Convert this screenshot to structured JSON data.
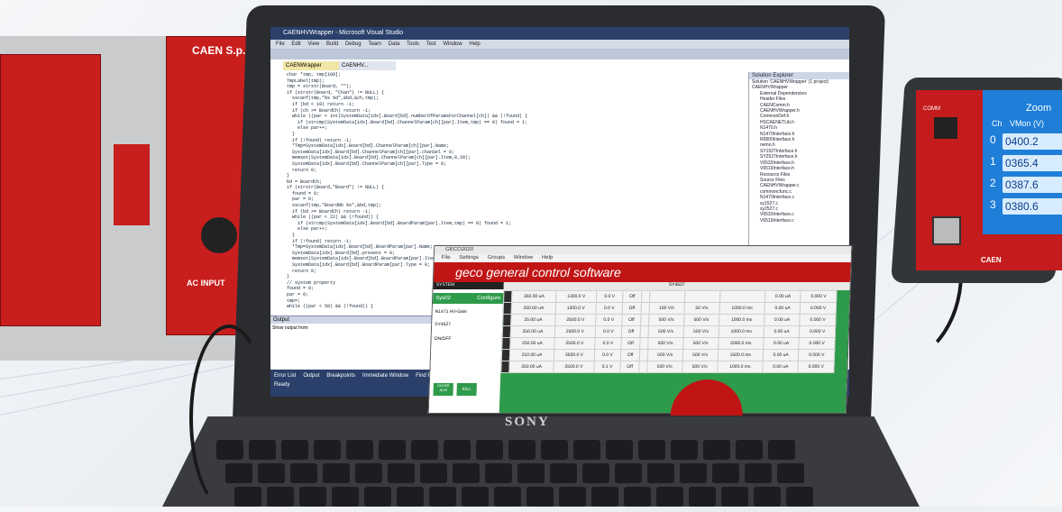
{
  "scene": "Laptop running IDE and GECO software connected to CAEN power supply units",
  "crate": {
    "logo": "CAEN S.p.A.",
    "label_ac_input": "AC INPUT"
  },
  "laptop": {
    "brand": "SONY",
    "ide": {
      "menu": [
        "File",
        "Edit",
        "View",
        "Build",
        "Debug",
        "Team",
        "Data",
        "Tools",
        "Test",
        "Window",
        "Help"
      ],
      "tabs": [
        "CAENWrapper",
        "CAENHV..."
      ],
      "code_lines": [
        "char *tmp, tmp[100];",
        "TmpLabel(tmp);",
        "",
        "tmp = strstr(Board, \"\");",
        "if (strstr(Board, \"Chan\") != NULL) {",
        "  sscanf(tmp,\"%s %d\",&bd,&ch,tmp);",
        "  if (bd < 19) return -1;",
        "  if (ch >= BoardCh) return -1;",
        "  while ((par < int)SystemData[idx].Board[bd].numberOfParamsForChannel[ch]) && (!found) {",
        "    if (strcmp(SystemData[idx].Board[bd].ChannelParam[ch][par].Item,tmp) == 0) found = 1;",
        "    else par++;",
        "  }",
        "  if (!found) return -1;",
        "  *Tmp=SystemData[idx].Board[bd].ChannelParam[ch][par].Name;",
        "  SystemData[idx].Board[bd].ChannelParam[ch][par].chanSel = 0;",
        "  memset(SystemData[idx].Board[bd].ChannelParam[ch][par].Item,0,20);",
        "  SystemData[idx].Board[bd].ChannelParam[ch][par].Type = 0;",
        "  return 0;",
        "}",
        "bd = BoardCh;",
        "if (strstr(Board,\"Board\") != NULL) {",
        "  found = 0;",
        "  par = 0;",
        "  sscanf(tmp,\"BoardNb %s\",&bd,tmp);",
        "  if (bd >= BoardCh) return -1;",
        "  while ((par < 22) && (!found)) {",
        "    if (strcmp(SystemData[idx].Board[bd].BoardParam[par].Item,tmp) == 0) found = 1;",
        "    else par++;",
        "  }",
        "  if (!found) return -1;",
        "  *Tmp=SystemData[idx].Board[bd].BoardParam[par].Name;",
        "  SystemData[idx].Board[bd].present = 0;",
        "  memset(SystemData[idx].Board[bd].BoardParam[par].Item,0,20);",
        "  SystemData[idx].Board[bd].BoardParam[par].Type = 0;",
        "  return 0;",
        "}",
        "// system property",
        "found = 0;",
        "par = 0;",
        "",
        "tmp=;",
        "while ((par < 50) && (!found)) {"
      ],
      "solution_explorer": {
        "header": "Solution Explorer",
        "items": [
          "Solution 'CAENHVWrapper' (1 project)",
          "CAENHVWrapper",
          "External Dependencies",
          "Header Files",
          "CAENComm.h",
          "CAENHVWrapper.h",
          "CommonDef.h",
          "HSCAENETLib.h",
          "N1470.h",
          "N1470Interface.h",
          "R5800Interface.h",
          "nemo.h",
          "SY1527Interface.h",
          "SY2527Interface.h",
          "V6533Interface.h",
          "V6519Interface.h",
          "Resource Files",
          "Source Files",
          "CAENHVWrapper.c",
          "commoncfunc.c",
          "N1470Interface.c",
          "sy1527.c",
          "sy2527.c",
          "V6533Interface.c",
          "V6519Interface.c"
        ]
      },
      "output_header": "Output",
      "output_source": "Show output from:",
      "status_text": "Ready",
      "bottom_tabs": [
        "Error List",
        "Output",
        "Breakpoints",
        "Immediate Window",
        "Find Results 1",
        "Find Symbol Results"
      ]
    },
    "geco": {
      "title": "GECO2020",
      "menu": [
        "File",
        "Settings",
        "Groups",
        "Window",
        "Help"
      ],
      "banner": "geco general control software",
      "left_header": "SYSTEM",
      "left_system": "Sys02",
      "left_configure": "Configure",
      "left_board": "SY4527",
      "left_board_label": "N1471 HV-Gain",
      "left_onoff": "ON/OFF",
      "left_buttons": [
        "CLEAR ALM",
        "KILL"
      ],
      "main_header": "SY4527",
      "rows": [
        [
          "",
          "350.00 uA",
          "1300.0 V",
          "0.0 V",
          "Off",
          "",
          "",
          "",
          "",
          "0.00 uA",
          "0.000 V"
        ],
        [
          "",
          "350.00 uA",
          "1300.0 V",
          "0.0 V",
          "Off",
          "",
          "100 V/s",
          "50 V/s",
          "1000.0 ms",
          "0.00 uA",
          "0.000 V"
        ],
        [
          "",
          "25.00 uA",
          "2500.0 V",
          "0.0 V",
          "Off",
          "",
          "500 V/s",
          "500 V/s",
          "1000.0 ms",
          "0.00 uA",
          "0.000 V"
        ],
        [
          "",
          "250.00 uA",
          "2500.0 V",
          "0.0 V",
          "Off",
          "",
          "500 V/s",
          "500 V/s",
          "1000.0 ms",
          "0.00 uA",
          "0.000 V"
        ],
        [
          "",
          "250.00 uA",
          "2500.0 V",
          "0.0 V",
          "Off",
          "",
          "500 V/s",
          "500 V/s",
          "2000.0 ms",
          "0.00 uA",
          "0.000 V"
        ],
        [
          "",
          "210.00 uA",
          "3500.0 V",
          "0.0 V",
          "Off",
          "",
          "500 V/s",
          "500 V/s",
          "1500.0 ms",
          "0.00 uA",
          "0.000 V"
        ],
        [
          "",
          "350.00 uA",
          "3500.0 V",
          "0.1 V",
          "Off",
          "",
          "500 V/s",
          "500 V/s",
          "1000.0 ms",
          "0.00 uA",
          "0.000 V"
        ]
      ]
    }
  },
  "device": {
    "screen_title": "Zoom",
    "col_ch": "Ch",
    "col_vmon": "VMon (V)",
    "readings": [
      {
        "ch": "0",
        "value": "0400.2"
      },
      {
        "ch": "1",
        "value": "0365.4"
      },
      {
        "ch": "2",
        "value": "0387.6"
      },
      {
        "ch": "3",
        "value": "0380.6"
      }
    ],
    "port_label": "COMM",
    "logo": "CAEN"
  }
}
